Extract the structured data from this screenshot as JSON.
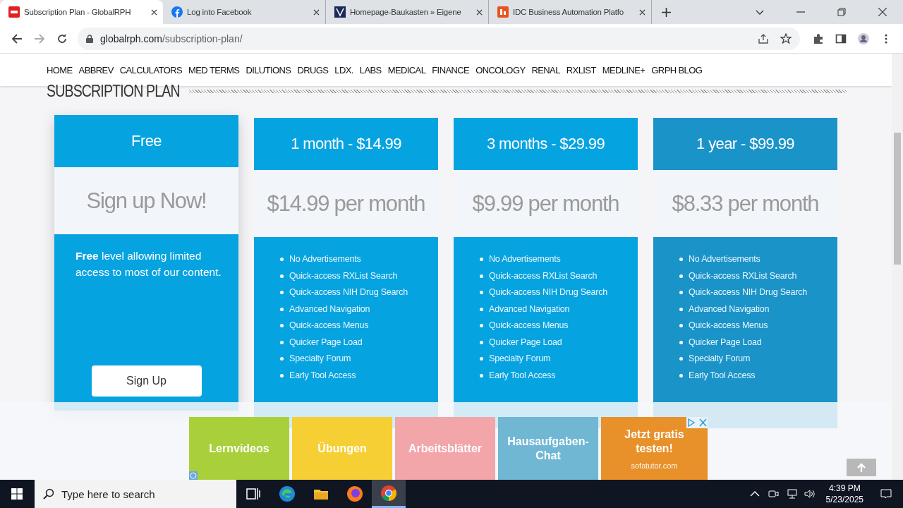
{
  "browser": {
    "tabs": [
      {
        "title": "Subscription Plan - GlobalRPH",
        "selected": true
      },
      {
        "title": "Log into Facebook",
        "selected": false
      },
      {
        "title": "Homepage-Baukasten » Eigene",
        "selected": false
      },
      {
        "title": "IDC Business Automation Platfo",
        "selected": false
      }
    ],
    "address": {
      "host": "globalrph.com",
      "path": "/subscription-plan/"
    }
  },
  "nav": [
    "HOME",
    "ABBREV",
    "CALCULATORS",
    "MED TERMS",
    "DILUTIONS",
    "DRUGS",
    "LDX.",
    "LABS",
    "MEDICAL",
    "FINANCE",
    "ONCOLOGY",
    "RENAL",
    "RXLIST",
    "MEDLINE+",
    "GRPH BLOG"
  ],
  "page_title": "SUBSCRIPTION PLAN",
  "plans": [
    {
      "kind": "free",
      "hovered": false,
      "header": "Free",
      "price": "Sign up Now!",
      "description": "**Free** level allowing limited access to most of our content.",
      "button": "Sign Up"
    },
    {
      "kind": "paid",
      "hovered": false,
      "header": "1 month - $14.99",
      "price": "$14.99 per month",
      "features": [
        "No Advertisements",
        "Quick-access RXList Search",
        "Quick-access NIH Drug Search",
        "Advanced Navigation",
        "Quick-access Menus",
        "Quicker Page Load",
        "Specialty Forum",
        "Early Tool Access"
      ]
    },
    {
      "kind": "paid",
      "hovered": false,
      "header": "3 months - $29.99",
      "price": "$9.99 per month",
      "features": [
        "No Advertisements",
        "Quick-access RXList Search",
        "Quick-access NIH Drug Search",
        "Advanced Navigation",
        "Quick-access Menus",
        "Quicker Page Load",
        "Specialty Forum",
        "Early Tool Access"
      ]
    },
    {
      "kind": "paid",
      "hovered": true,
      "header": "1 year - $99.99",
      "price": "$8.33 per month",
      "features": [
        "No Advertisements",
        "Quick-access RXList Search",
        "Quick-access NIH Drug Search",
        "Advanced Navigation",
        "Quick-access Menus",
        "Quicker Page Load",
        "Specialty Forum",
        "Early Tool Access"
      ]
    }
  ],
  "ad": {
    "tiles": [
      {
        "label": "Lernvideos",
        "color": "#a9d03b"
      },
      {
        "label": "Übungen",
        "color": "#f6cf35"
      },
      {
        "label": "Arbeitsblätter",
        "color": "#f2a6aa"
      },
      {
        "label": "Hausaufgaben-Chat",
        "color": "#70b7d3"
      },
      {
        "label": "Jetzt gratis testen!",
        "color": "#e8912a",
        "sub": "sofatutor.com"
      }
    ]
  },
  "taskbar": {
    "search_placeholder": "Type here to search",
    "apps": [
      {
        "kind": "taskview",
        "selected": false
      },
      {
        "kind": "edge",
        "selected": false
      },
      {
        "kind": "files",
        "selected": false
      },
      {
        "kind": "firefox",
        "selected": false
      },
      {
        "kind": "chrome",
        "selected": true
      }
    ],
    "time": "4:39 PM",
    "date": "5/23/2025"
  }
}
